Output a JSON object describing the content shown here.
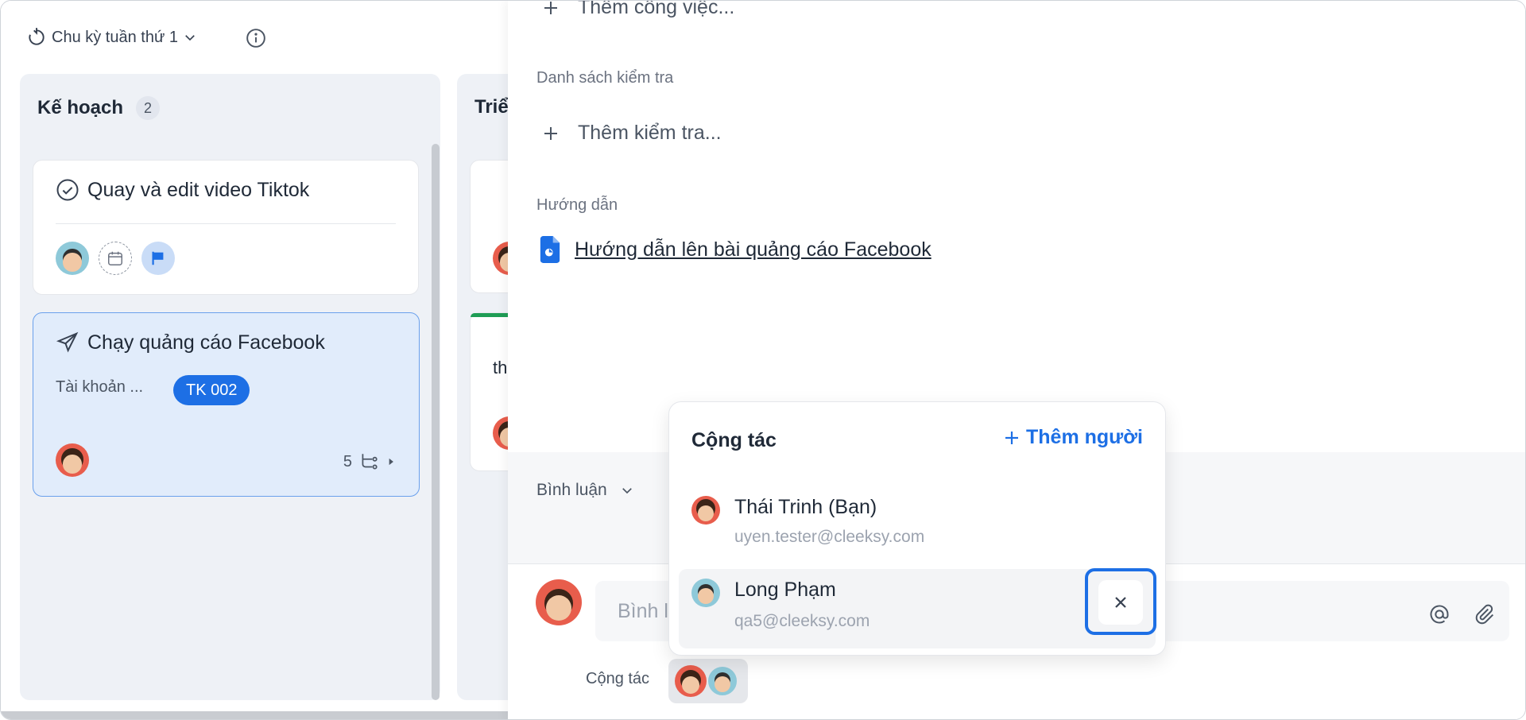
{
  "board": {
    "cycle_label": "Chu kỳ tuần thứ 1",
    "columns": [
      {
        "title": "Kế hoạch",
        "count": "2",
        "cards": [
          {
            "title": "Quay và edit video Tiktok"
          },
          {
            "title": "Chạy quảng cáo Facebook",
            "account_label": "Tài khoản ...",
            "badge": "TK 002",
            "subtask_count": "5"
          }
        ]
      },
      {
        "title": "Triể",
        "partial_text": "th"
      }
    ]
  },
  "panel": {
    "add_task_label": "Thêm công việc...",
    "checklist_section": "Danh sách kiểm tra",
    "add_check_label": "Thêm kiểm tra...",
    "guide_section": "Hướng dẫn",
    "guide_link": "Hướng dẫn lên bài quảng cáo Facebook",
    "comments_label": "Bình luận",
    "comment_placeholder": "Bình luận",
    "collab_footer_label": "Cộng tác"
  },
  "popover": {
    "title": "Cộng tác",
    "add_person": "Thêm người",
    "members": [
      {
        "name": "Thái Trinh (Bạn)",
        "email": "uyen.tester@cleeksy.com"
      },
      {
        "name": "Long Phạm",
        "email": "qa5@cleeksy.com"
      }
    ]
  },
  "colors": {
    "accent": "#1d6fe5",
    "selected_card_bg": "#e1ecfb",
    "column_bg": "#eef1f6",
    "badge_bg": "#1d6fe5"
  }
}
